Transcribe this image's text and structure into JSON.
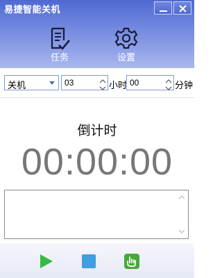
{
  "window": {
    "title": "易捷智能关机"
  },
  "toolbar": {
    "tasks_label": "任务",
    "settings_label": "设置"
  },
  "controls": {
    "action": {
      "value": "关机"
    },
    "hours": {
      "value": "03",
      "unit": "小时"
    },
    "minutes": {
      "value": "00",
      "unit": "分钟"
    }
  },
  "main": {
    "countdown_label": "倒计时",
    "countdown_value": "00:00:00",
    "log_text": ""
  },
  "footer": {
    "play": {
      "icon": "play-icon",
      "color": "#33bb44"
    },
    "stop": {
      "icon": "stop-icon",
      "color": "#3f9fe0"
    },
    "hand": {
      "icon": "hand-icon",
      "color": "#4aa83a"
    }
  },
  "colors": {
    "header_top": "#4f69d2",
    "header_bottom": "#aab8ef",
    "countdown_text": "#777777",
    "field_border": "#7a9cd4"
  }
}
